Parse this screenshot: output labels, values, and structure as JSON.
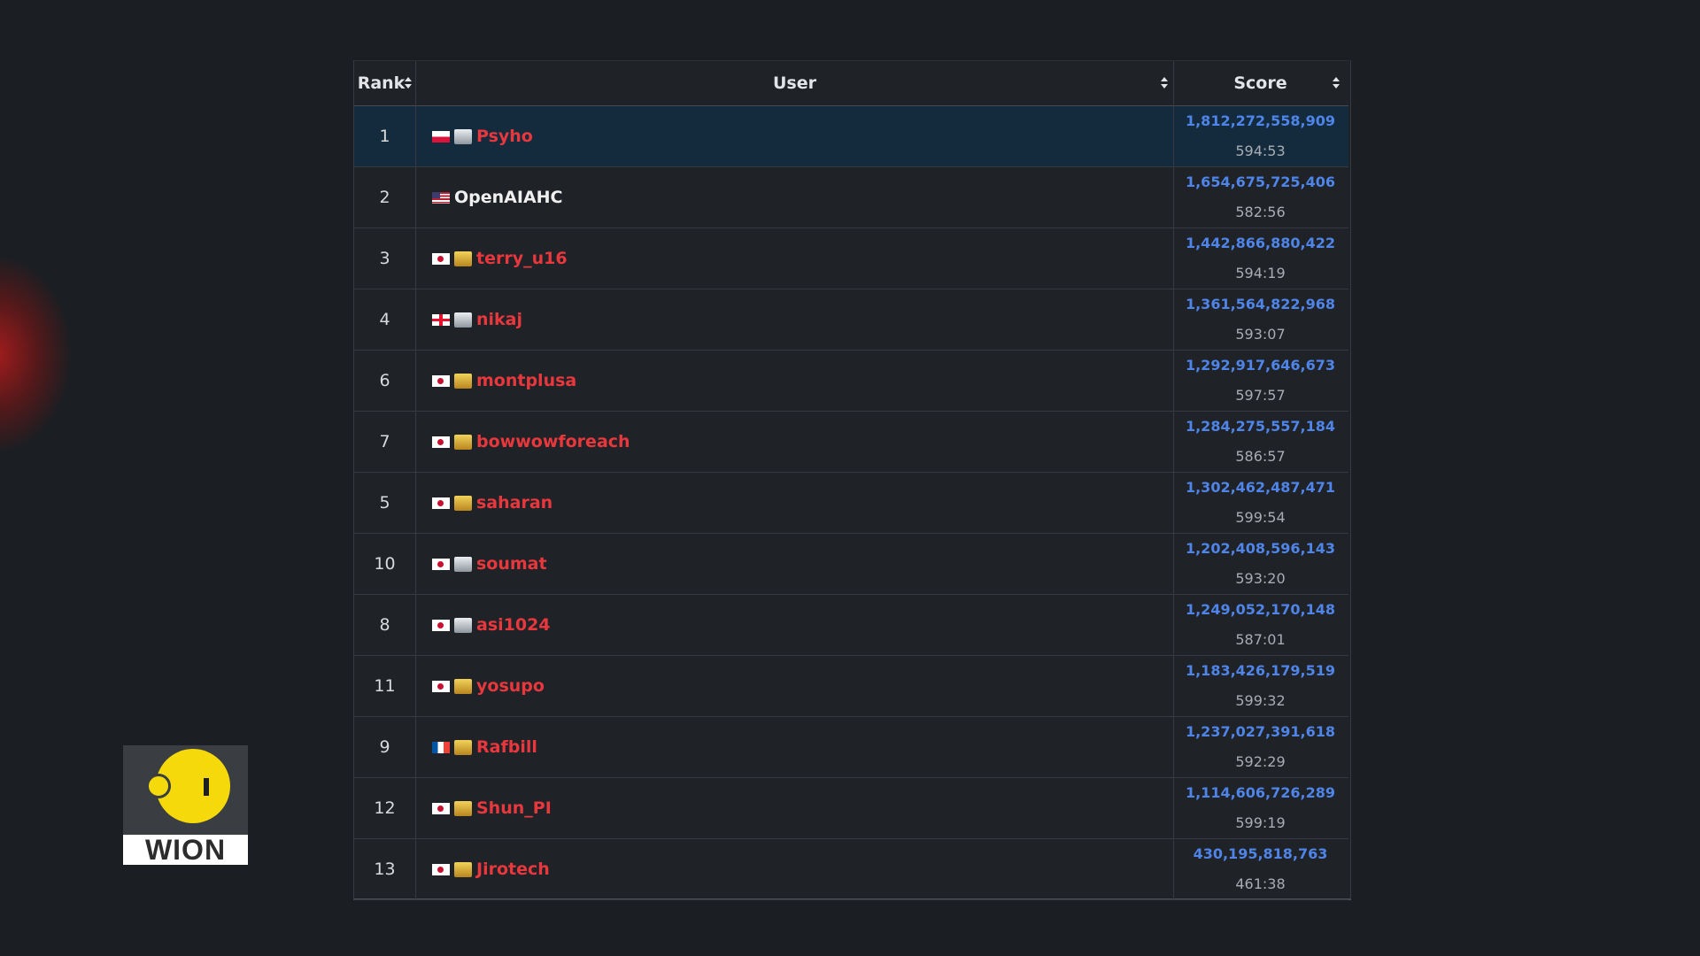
{
  "table": {
    "headers": {
      "rank": "Rank",
      "user": "User",
      "score": "Score"
    },
    "rows": [
      {
        "rank": "1",
        "country": "pl",
        "tier": "silver",
        "name": "Psyho",
        "color": "red",
        "score": "1,812,272,558,909",
        "time": "594:53",
        "highlighted": true
      },
      {
        "rank": "2",
        "country": "us",
        "tier": "none",
        "name": "OpenAIAHC",
        "color": "white",
        "score": "1,654,675,725,406",
        "time": "582:56"
      },
      {
        "rank": "3",
        "country": "jp",
        "tier": "gold",
        "name": "terry_u16",
        "color": "red",
        "score": "1,442,866,880,422",
        "time": "594:19"
      },
      {
        "rank": "4",
        "country": "ge",
        "tier": "silver",
        "name": "nikaj",
        "color": "red",
        "score": "1,361,564,822,968",
        "time": "593:07"
      },
      {
        "rank": "6",
        "country": "jp",
        "tier": "gold",
        "name": "montplusa",
        "color": "red",
        "score": "1,292,917,646,673",
        "time": "597:57"
      },
      {
        "rank": "7",
        "country": "jp",
        "tier": "gold",
        "name": "bowwowforeach",
        "color": "red",
        "score": "1,284,275,557,184",
        "time": "586:57"
      },
      {
        "rank": "5",
        "country": "jp",
        "tier": "gold",
        "name": "saharan",
        "color": "red",
        "score": "1,302,462,487,471",
        "time": "599:54"
      },
      {
        "rank": "10",
        "country": "jp",
        "tier": "silver",
        "name": "soumat",
        "color": "red",
        "score": "1,202,408,596,143",
        "time": "593:20"
      },
      {
        "rank": "8",
        "country": "jp",
        "tier": "silver",
        "name": "asi1024",
        "color": "red",
        "score": "1,249,052,170,148",
        "time": "587:01"
      },
      {
        "rank": "11",
        "country": "jp",
        "tier": "gold",
        "name": "yosupo",
        "color": "red",
        "score": "1,183,426,179,519",
        "time": "599:32"
      },
      {
        "rank": "9",
        "country": "fr",
        "tier": "gold",
        "name": "Rafbill",
        "color": "red",
        "score": "1,237,027,391,618",
        "time": "592:29"
      },
      {
        "rank": "12",
        "country": "jp",
        "tier": "gold",
        "name": "Shun_PI",
        "color": "red",
        "score": "1,114,606,726,289",
        "time": "599:19"
      },
      {
        "rank": "13",
        "country": "jp",
        "tier": "gold",
        "name": "Jirotech",
        "color": "red",
        "score": "430,195,818,763",
        "time": "461:38"
      }
    ]
  },
  "logo": {
    "text": "WION"
  },
  "colors": {
    "background": "#1b1e22",
    "highlight_row": "#132b3d",
    "username_red": "#e8383d",
    "score_blue": "#4f84e8"
  },
  "icons": {
    "sort": "sort-updown-icon",
    "crown": "crown-icon"
  }
}
